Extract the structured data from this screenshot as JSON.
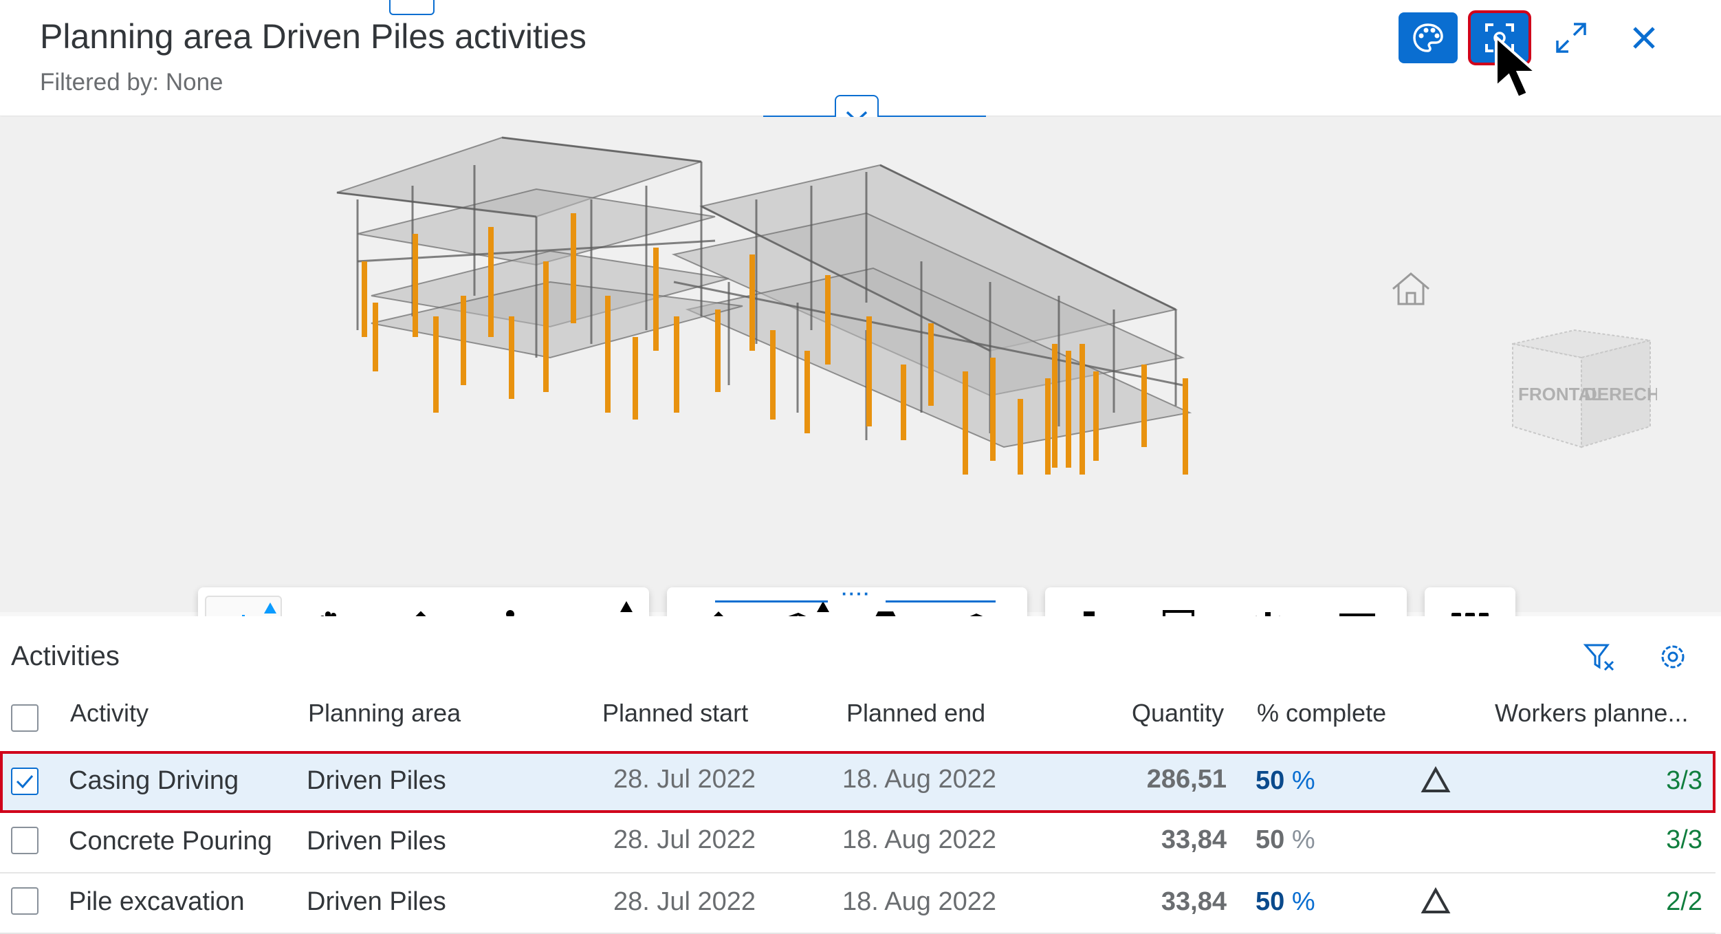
{
  "header": {
    "title": "Planning area Driven Piles activities",
    "subtitle": "Filtered by: None"
  },
  "navcube": {
    "front_label": "FRONTAL",
    "right_label": "DERECHA"
  },
  "table": {
    "title": "Activities",
    "columns": {
      "activity": "Activity",
      "planning_area": "Planning area",
      "planned_start": "Planned start",
      "planned_end": "Planned end",
      "quantity": "Quantity",
      "percent_complete": "% complete",
      "workers_planned": "Workers planne..."
    },
    "rows": [
      {
        "activity": "Casing Driving",
        "planning_area": "Driven Piles",
        "planned_start": "28. Jul 2022",
        "planned_end": "18. Aug 2022",
        "quantity": "286,51",
        "percent": "50",
        "percent_unit": "%",
        "warning": true,
        "workers": "3/3",
        "selected": true
      },
      {
        "activity": "Concrete Pouring",
        "planning_area": "Driven Piles",
        "planned_start": "28. Jul 2022",
        "planned_end": "18. Aug 2022",
        "quantity": "33,84",
        "percent": "50",
        "percent_unit": "%",
        "warning": false,
        "workers": "3/3",
        "selected": false
      },
      {
        "activity": "Pile excavation",
        "planning_area": "Driven Piles",
        "planned_start": "28. Jul 2022",
        "planned_end": "18. Aug 2022",
        "quantity": "33,84",
        "percent": "50",
        "percent_unit": "%",
        "warning": true,
        "workers": "2/2",
        "selected": false
      }
    ]
  },
  "colors": {
    "accent": "#0a6ed1",
    "selection_outline": "#d0021b",
    "pile_orange": "#e8920f",
    "workers_green": "#107e3e",
    "warning_color": "#32363a"
  }
}
